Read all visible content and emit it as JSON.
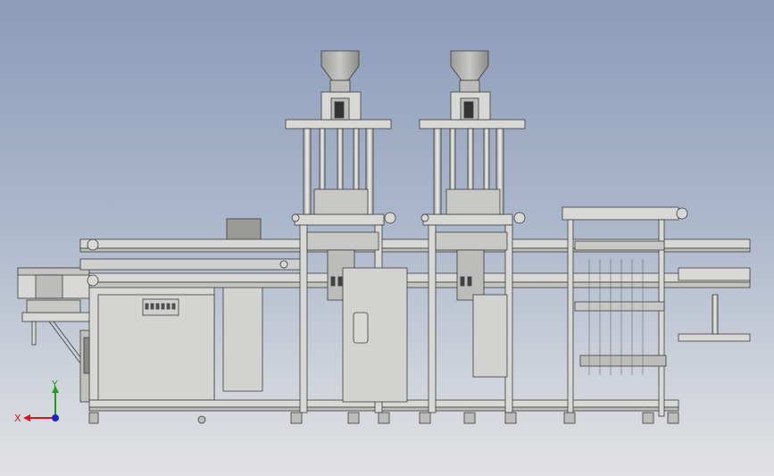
{
  "viewport": {
    "background_top": "#8c9cb9",
    "background_bottom": "#e2e2e4",
    "model_fill": "#d8d8d6",
    "model_stroke": "#3c3c3c"
  },
  "triad": {
    "x_label": "X",
    "y_label": "Y",
    "x_color": "#d01818",
    "y_color": "#18a018",
    "z_color": "#1828c8"
  }
}
